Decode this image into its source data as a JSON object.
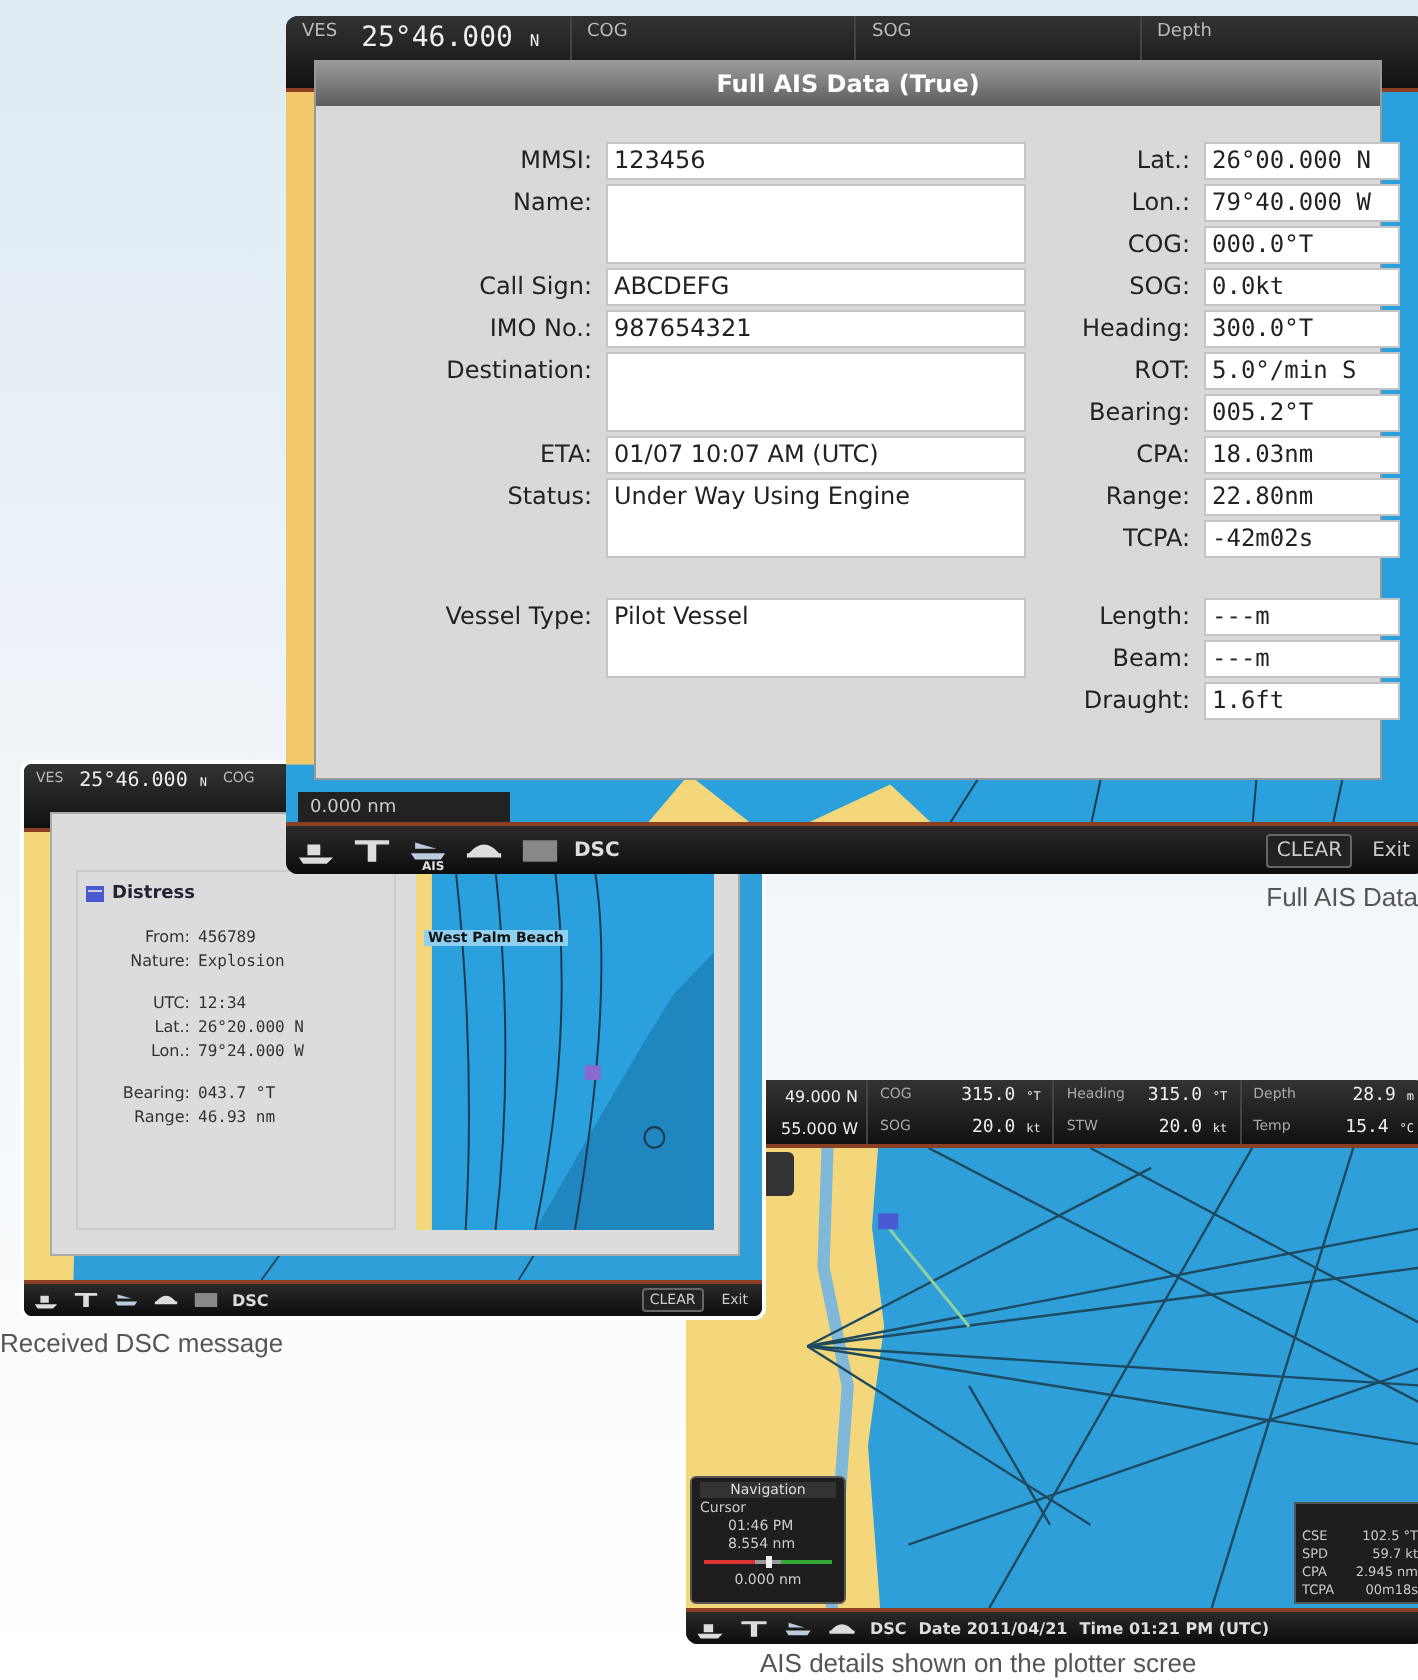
{
  "full_ais_screen": {
    "status_bar": [
      {
        "label": "VES",
        "value": "25°46.000",
        "unit": "N"
      },
      {
        "label": "COG"
      },
      {
        "label": "SOG"
      },
      {
        "label": "Depth"
      }
    ],
    "dialog": {
      "title": "Full AIS Data (True)",
      "left_sections": [
        [
          {
            "label": "MMSI:",
            "value": "123456",
            "kind": "single"
          },
          {
            "label": "Name:",
            "kind": "multi"
          },
          {
            "label": "Call Sign:",
            "value": "ABCDEFG",
            "kind": "single"
          },
          {
            "label": "IMO No.:",
            "value": "987654321",
            "kind": "single"
          },
          {
            "label": "Destination:",
            "kind": "multi"
          },
          {
            "label": "ETA:",
            "value": "01/07 10:07 AM (UTC)",
            "kind": "single"
          },
          {
            "label": "Status:",
            "value": "Under Way Using Engine",
            "kind": "multi"
          }
        ],
        [
          {
            "label": "Vessel Type:",
            "value": "Pilot Vessel",
            "kind": "multi"
          }
        ]
      ],
      "right_sections": [
        [
          {
            "label": "Lat.:",
            "value": "26°00.000 N"
          },
          {
            "label": "Lon.:",
            "value": "79°40.000 W"
          },
          {
            "label": "COG:",
            "value": "000.0°T"
          },
          {
            "label": "SOG:",
            "value": "0.0kt"
          },
          {
            "label": "Heading:",
            "value": "300.0°T"
          },
          {
            "label": "ROT:",
            "value": "5.0°/min S"
          },
          {
            "label": "Bearing:",
            "value": "005.2°T"
          },
          {
            "label": "CPA:",
            "value": "18.03nm"
          },
          {
            "label": "Range:",
            "value": "22.80nm"
          },
          {
            "label": "TCPA:",
            "value": "-42m02s"
          }
        ],
        [
          {
            "label": "Length:",
            "value": "---m"
          },
          {
            "label": "Beam:",
            "value": "---m"
          },
          {
            "label": "Draught:",
            "value": "1.6ft"
          }
        ]
      ]
    },
    "range_readout": "0.000 nm",
    "toolbar": {
      "ais_label": "AIS",
      "dsc_label": "DSC",
      "clear_button": "CLEAR",
      "exit_button": "Exit"
    },
    "caption": "Full AIS Data"
  },
  "dsc_screen": {
    "status_bar": [
      {
        "label": "VES",
        "value": "25°46.000",
        "unit": "N"
      },
      {
        "label": "COG"
      }
    ],
    "message": {
      "title": "Distress",
      "groups": [
        [
          {
            "label": "From:",
            "value": "456789"
          },
          {
            "label": "Nature:",
            "value": "Explosion"
          }
        ],
        [
          {
            "label": "UTC:",
            "value": "12:34"
          },
          {
            "label": "Lat.:",
            "value": "26°20.000 N"
          },
          {
            "label": "Lon.:",
            "value": "79°24.000 W"
          }
        ],
        [
          {
            "label": "Bearing:",
            "value": "043.7 °T"
          },
          {
            "label": "Range:",
            "value": "46.93 nm"
          }
        ]
      ]
    },
    "map_label": "West Palm Beach",
    "toolbar": {
      "dsc_label": "DSC",
      "clear_button": "CLEAR",
      "exit_button": "Exit"
    },
    "caption": "Received DSC message"
  },
  "plotter_screen": {
    "position": [
      "49.000 N",
      "55.000 W"
    ],
    "columns": [
      [
        {
          "label": "COG",
          "value": "315.0",
          "unit": "°T"
        },
        {
          "label": "SOG",
          "value": "20.0",
          "unit": "kt"
        }
      ],
      [
        {
          "label": "Heading",
          "value": "315.0",
          "unit": "°T"
        },
        {
          "label": "STW",
          "value": "20.0",
          "unit": "kt"
        }
      ],
      [
        {
          "label": "Depth",
          "value": "28.9",
          "unit": "m"
        },
        {
          "label": "Temp",
          "value": "15.4",
          "unit": "°C"
        }
      ]
    ],
    "navigation_panel": {
      "title": "Navigation",
      "cursor_label": "Cursor",
      "time": "01:46 PM",
      "distance": "8.554 nm",
      "range": "0.000 nm",
      "level": 0.5
    },
    "target_panel": [
      {
        "label": "CSE",
        "value": "102.5 °T"
      },
      {
        "label": "SPD",
        "value": "59.7 kt"
      },
      {
        "label": "CPA",
        "value": "2.945 nm"
      },
      {
        "label": "TCPA",
        "value": "00m18s"
      }
    ],
    "toolbar": {
      "dsc_label": "DSC",
      "date": "Date 2011/04/21",
      "time": "Time 01:21 PM (UTC)"
    },
    "caption": "AIS details shown on the plotter scree"
  }
}
